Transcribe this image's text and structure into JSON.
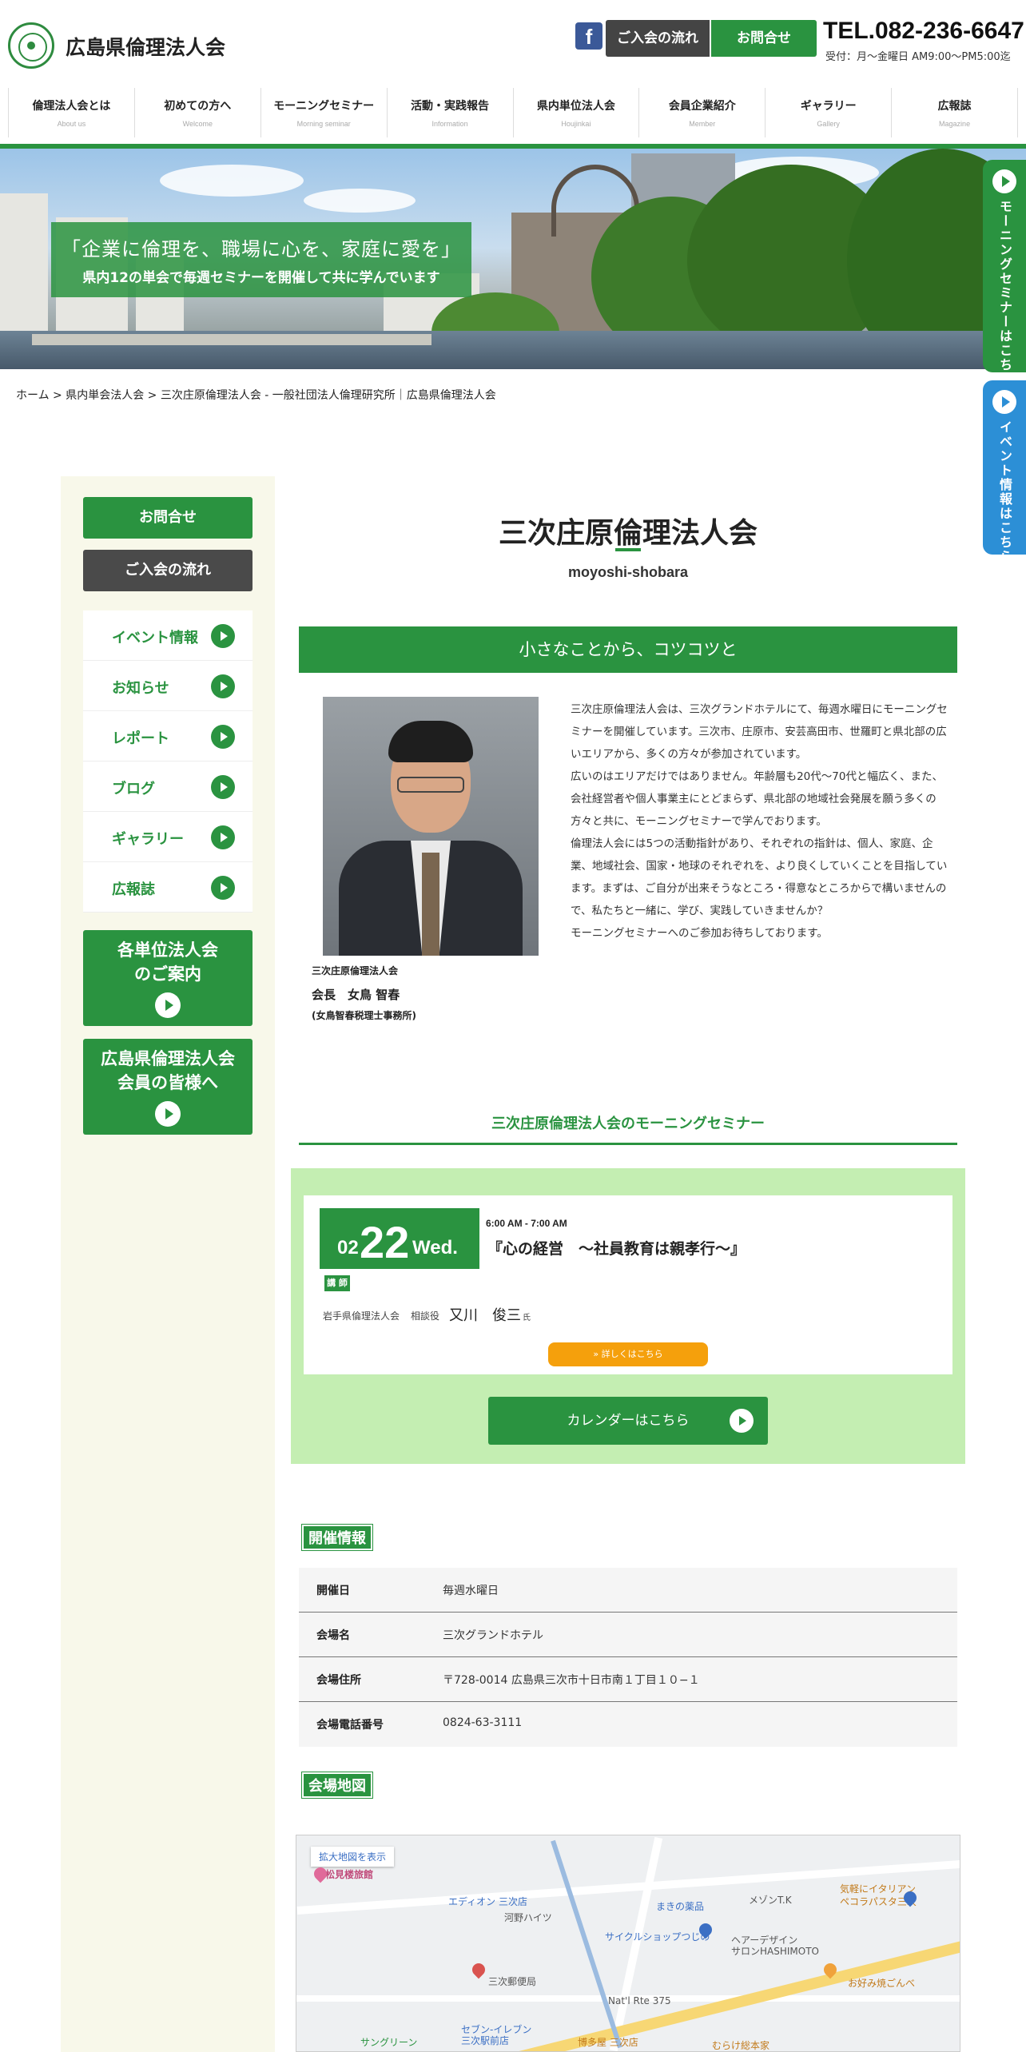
{
  "header": {
    "site_name": "広島県倫理法人会",
    "facebook_icon_text": "f",
    "btn_flow": "ご入会の流れ",
    "btn_contact": "お問合せ",
    "tel": "TEL.082-236-6647",
    "hours": "受付：月〜金曜日 AM9:00〜PM5:00迄"
  },
  "nav": [
    {
      "jp": "倫理法人会とは",
      "en": "About us"
    },
    {
      "jp": "初めての方へ",
      "en": "Welcome"
    },
    {
      "jp": "モーニングセミナー",
      "en": "Morning seminar"
    },
    {
      "jp": "活動・実践報告",
      "en": "Information"
    },
    {
      "jp": "県内単位法人会",
      "en": "Houjinkai"
    },
    {
      "jp": "会員企業紹介",
      "en": "Member"
    },
    {
      "jp": "ギャラリー",
      "en": "Gallery"
    },
    {
      "jp": "広報誌",
      "en": "Magazine"
    }
  ],
  "hero": {
    "line1": "「企業に倫理を、職場に心を、家庭に愛を」",
    "line2": "県内12の単会で毎週セミナーを開催して共に学んでいます"
  },
  "side_tabs": {
    "morning": "モーニングセミナーはこちら",
    "event": "イベント情報はこちら"
  },
  "breadcrumb": "ホーム > 県内単会法人会 > 三次庄原倫理法人会 - 一般社団法人倫理研究所｜広島県倫理法人会",
  "sidebar": {
    "contact": "お問合せ",
    "flow": "ご入会の流れ",
    "menu": [
      "イベント情報",
      "お知らせ",
      "レポート",
      "ブログ",
      "ギャラリー",
      "広報誌"
    ],
    "big1": [
      "各単位法人会",
      "のご案内"
    ],
    "big2": [
      "広島県倫理法人会",
      "会員の皆様へ"
    ]
  },
  "main": {
    "title": "三次庄原倫理法人会",
    "subtitle": "moyoshi-shobara",
    "banner": "小さなことから、コツコツと",
    "caption1": "三次庄原倫理法人会",
    "caption2": "会長　女鳥 智春",
    "caption3": "(女鳥智春税理士事務所)",
    "description": [
      "三次庄原倫理法人会は、三次グランドホテルにて、毎週水曜日にモーニングセミナーを開催しています。三次市、庄原市、安芸高田市、世羅町と県北部の広いエリアから、多くの方々が参加されています。",
      "広いのはエリアだけではありません。年齢層も20代～70代と幅広く、また、会社経営者や個人事業主にとどまらず、県北部の地域社会発展を願う多くの方々と共に、モーニングセミナーで学んでおります。",
      "倫理法人会には5つの活動指針があり、それぞれの指針は、個人、家庭、企業、地域社会、国家・地球のそれぞれを、より良くしていくことを目指しています。まずは、ご自分が出来そうなところ・得意なところからで構いませんので、私たちと一緒に、学び、実践していきませんか？",
      "モーニングセミナーへのご参加お待ちしております。"
    ],
    "seminar_heading": "三次庄原倫理法人会のモーニングセミナー"
  },
  "event": {
    "month": "02",
    "day": "22",
    "weekday": "Wed.",
    "time": "6:00 AM - 7:00 AM",
    "title": "『心の経営　～社員教育は親孝行～』",
    "lecturer_tag": "講 師",
    "lecturer_org": "岩手県倫理法人会",
    "lecturer_role": "相談役",
    "lecturer_name": "又川　俊三",
    "lecturer_honorific": "氏",
    "details": "» 詳しくはこちら",
    "calendar": "カレンダーはこちら"
  },
  "info": {
    "heading": "開催情報",
    "rows": [
      {
        "k": "開催日",
        "v": "毎週水曜日"
      },
      {
        "k": "会場名",
        "v": "三次グランドホテル"
      },
      {
        "k": "会場住所",
        "v": "〒728-0014 広島県三次市十日市南１丁目１０−１"
      },
      {
        "k": "会場電話番号",
        "v": "0824-63-3111"
      }
    ]
  },
  "map": {
    "heading": "会場地図",
    "link": "拡大地図を表示",
    "labels": [
      "松見楼旅館",
      "エディオン 三次店",
      "河野ハイツ",
      "まきの薬品",
      "メゾンT.K",
      "気軽にイタリアン",
      "ペコラパスタ三次",
      "サイクルショップつじの",
      "ヘアーデザイン",
      "サロンHASHIMOTO",
      "三次郵便局",
      "お好み焼ごんべ",
      "Nat'l Rte 375",
      "セブン-イレブン",
      "三次駅前店",
      "博多屋 三次店",
      "むらけ総本家",
      "サングリーン"
    ]
  },
  "colors": {
    "brand_green": "#2a9340",
    "light_green": "#c4eeb2",
    "orange": "#f5a00c",
    "blue_tab": "#2c8fd6",
    "dark_btn": "#444444"
  }
}
